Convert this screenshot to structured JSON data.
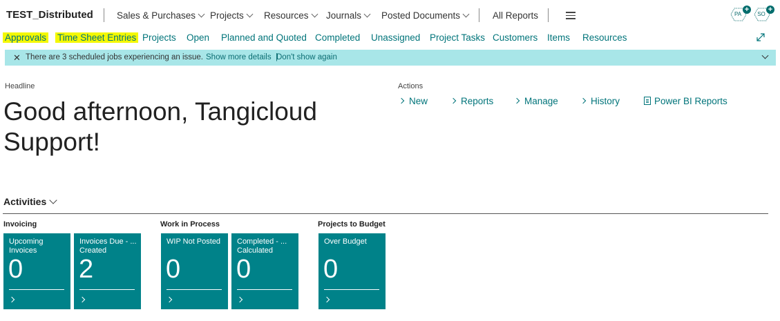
{
  "app": {
    "company": "TEST_Distributed"
  },
  "topnav": {
    "menus": [
      {
        "label": "Sales & Purchases"
      },
      {
        "label": "Projects"
      },
      {
        "label": "Resources"
      },
      {
        "label": "Journals"
      },
      {
        "label": "Posted Documents"
      }
    ],
    "all_reports": "All Reports"
  },
  "avatars": [
    {
      "initials": "PA"
    },
    {
      "initials": "SO"
    }
  ],
  "subnav": {
    "items": [
      {
        "label": "Approvals",
        "highlighted": true
      },
      {
        "label": "Time Sheet Entries",
        "highlighted": true
      },
      {
        "label": "Projects"
      },
      {
        "label": "Open"
      },
      {
        "label": "Planned and Quoted"
      },
      {
        "label": "Completed"
      },
      {
        "label": "Unassigned"
      },
      {
        "label": "Project Tasks"
      },
      {
        "label": "Customers"
      },
      {
        "label": "Items"
      },
      {
        "label": "Resources"
      }
    ]
  },
  "notification": {
    "message": "There are 3 scheduled jobs experiencing an issue.",
    "show_more": "Show more details",
    "dont_show": "Don't show again"
  },
  "headline": {
    "label": "Headline",
    "greeting": "Good afternoon, Tangicloud Support!"
  },
  "actions": {
    "label": "Actions",
    "items": [
      {
        "label": "New"
      },
      {
        "label": "Reports"
      },
      {
        "label": "Manage"
      },
      {
        "label": "History"
      },
      {
        "label": "Power BI Reports"
      }
    ]
  },
  "activities": {
    "title": "Activities",
    "groups": [
      {
        "title": "Invoicing",
        "tiles": [
          {
            "label": "Upcoming Invoices",
            "value": "0"
          },
          {
            "label": "Invoices Due - ... Created",
            "value": "2"
          }
        ]
      },
      {
        "title": "Work in Process",
        "tiles": [
          {
            "label": "WIP Not Posted",
            "value": "0"
          },
          {
            "label": "Completed - ... Calculated",
            "value": "0"
          }
        ]
      },
      {
        "title": "Projects to Budget",
        "tiles": [
          {
            "label": "Over Budget",
            "value": "0"
          }
        ]
      }
    ]
  },
  "colors": {
    "accent": "#00747a",
    "tile": "#008289",
    "notification_bg": "#a8e6e8",
    "highlight": "#f4f800"
  }
}
